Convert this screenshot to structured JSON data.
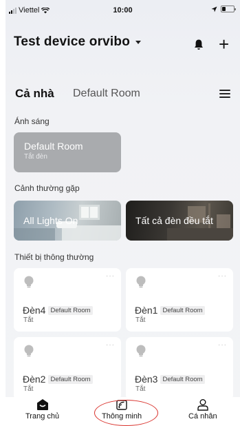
{
  "status_bar": {
    "carrier": "Viettel",
    "time": "10:00",
    "icons": [
      "signal-icon",
      "wifi-icon",
      "location-arrow-icon",
      "battery-icon"
    ]
  },
  "header": {
    "title": "Test device orvibo",
    "icons": [
      "chevron-down-icon",
      "bell-icon",
      "plus-icon"
    ]
  },
  "rooms": {
    "active": "Cả nhà",
    "tabs": [
      "Cả nhà",
      "Default Room"
    ],
    "menu_icon": "menu-icon"
  },
  "lighting": {
    "section_title": "Ánh sáng",
    "card": {
      "name": "Default Room",
      "status": "Tắt đèn"
    }
  },
  "scenes": {
    "section_title": "Cảnh thường gặp",
    "items": [
      {
        "label": "All Lights On"
      },
      {
        "label": "Tất cả đèn đều tắt"
      }
    ]
  },
  "devices": {
    "section_title": "Thiết bị thông thường",
    "items": [
      {
        "name": "Đèn4",
        "room": "Default Room",
        "state": "Tắt",
        "icon": "bulb-icon"
      },
      {
        "name": "Đèn1",
        "room": "Default Room",
        "state": "Tắt",
        "icon": "bulb-icon"
      },
      {
        "name": "Đèn2",
        "room": "Default Room",
        "state": "Tắt",
        "icon": "bulb-icon"
      },
      {
        "name": "Đèn3",
        "room": "Default Room",
        "state": "Tắt",
        "icon": "bulb-icon"
      }
    ],
    "more_glyph": "···"
  },
  "bottom_nav": {
    "items": [
      {
        "label": "Trang chủ",
        "icon": "home-icon"
      },
      {
        "label": "Thông minh",
        "icon": "smart-scene-icon"
      },
      {
        "label": "Cá nhân",
        "icon": "profile-icon"
      }
    ],
    "highlight_color": "#d9312b"
  }
}
